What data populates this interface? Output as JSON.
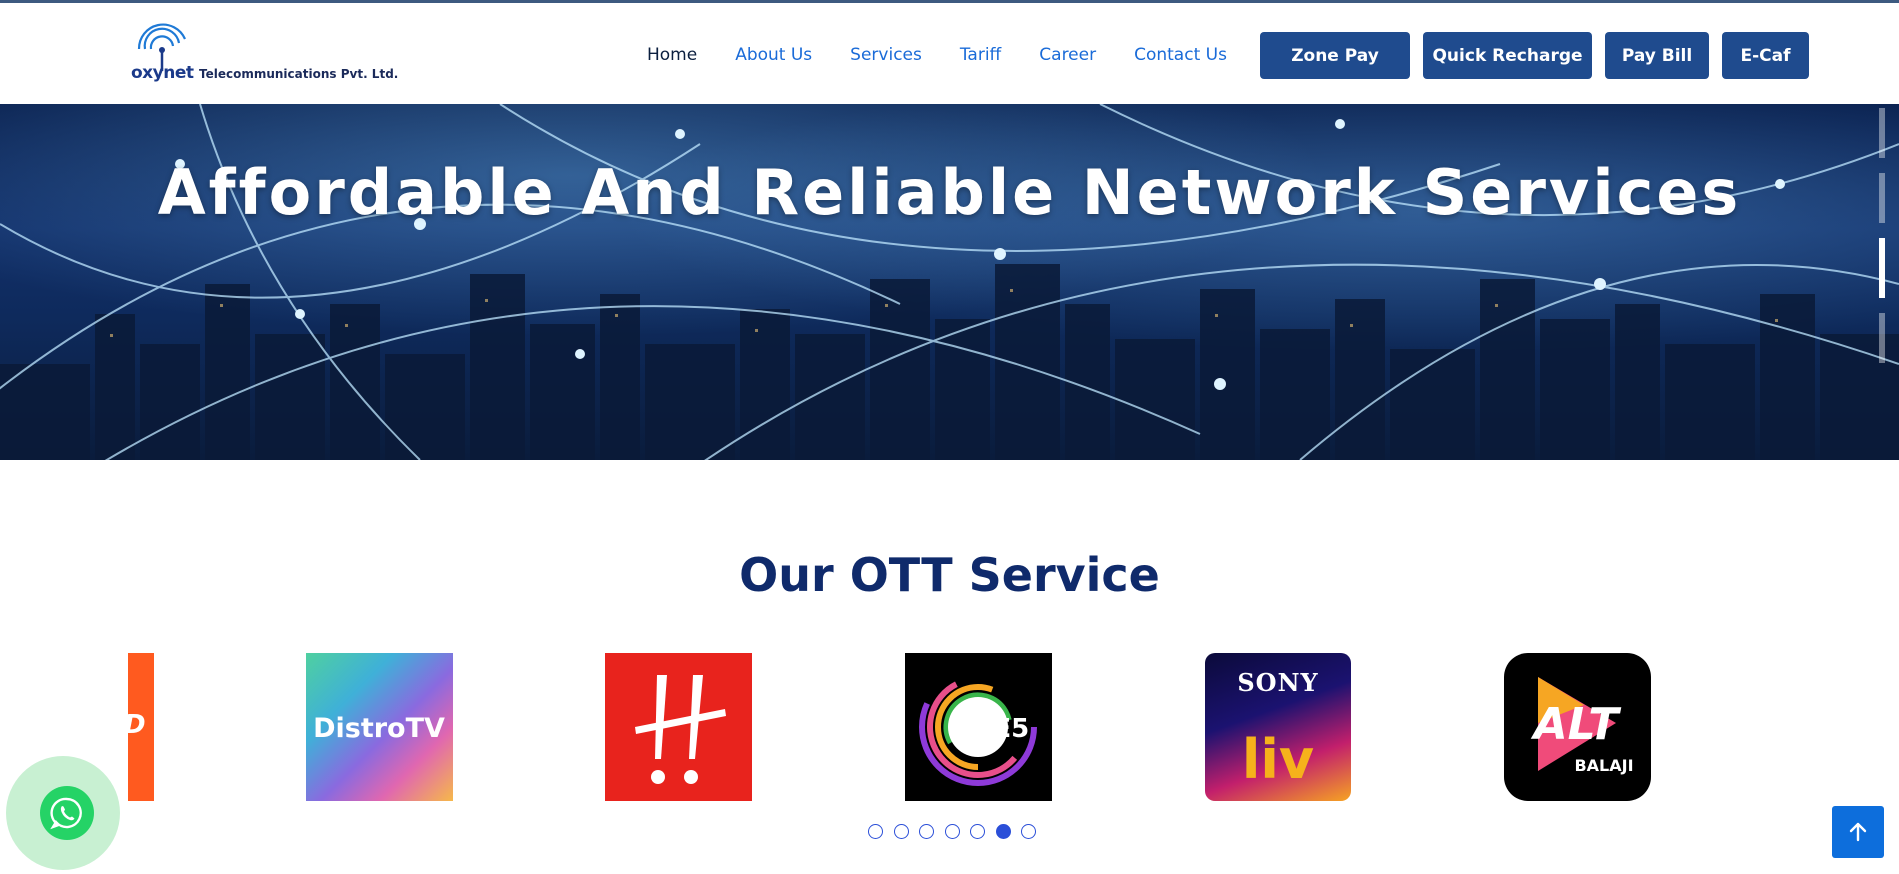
{
  "header": {
    "logo_word": "oxynet",
    "logo_tagline": "Telecommunications Pvt. Ltd.",
    "nav": [
      {
        "label": "Home"
      },
      {
        "label": "About Us"
      },
      {
        "label": "Services"
      },
      {
        "label": "Tariff"
      },
      {
        "label": "Career"
      },
      {
        "label": "Contact Us"
      }
    ],
    "cta": [
      {
        "label": "Zone Pay"
      },
      {
        "label": "Quick Recharge"
      },
      {
        "label": "Pay Bill"
      },
      {
        "label": "E-Caf"
      }
    ]
  },
  "hero": {
    "title": "Affordable And Reliable Network Services",
    "slide_count": 4,
    "active_slide": 3
  },
  "ott": {
    "title": "Our OTT Service",
    "logos": [
      {
        "name": "partial-orange-logo"
      },
      {
        "name": "Distro TV",
        "text": "DistroTV"
      },
      {
        "name": "Hungama",
        "text": "!!"
      },
      {
        "name": "ZEE5",
        "text": "ZEE5"
      },
      {
        "name": "Sony LIV",
        "text_top": "SONY",
        "text_bottom": "liv"
      },
      {
        "name": "ALT Balaji",
        "text_top": "ALT",
        "text_bottom": "BALAJI"
      }
    ],
    "carousel_dots": 7,
    "active_dot": 6
  },
  "colors": {
    "brand_blue": "#1f4b8e",
    "link_blue": "#1a6bd8",
    "heading_navy": "#0f2a6b",
    "whatsapp_green": "#25d366",
    "scroll_top_blue": "#0d6edc"
  },
  "icons": {
    "whatsapp": "whatsapp-icon",
    "scroll_top": "arrow-up-icon"
  }
}
